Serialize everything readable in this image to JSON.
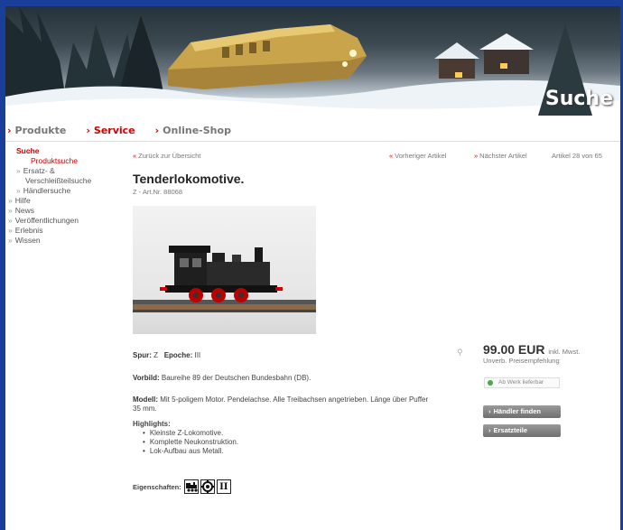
{
  "banner": {
    "title": "Suche"
  },
  "topnav": [
    {
      "label": "Produkte"
    },
    {
      "label": "Service"
    },
    {
      "label": "Online-Shop"
    }
  ],
  "sidebar": {
    "head": "Suche",
    "produktsuche": "Produktsuche",
    "ersatz": "Ersatz- &",
    "ersatz2": "Verschleißteilsuche",
    "haendler": "Händlersuche",
    "items": [
      "Hilfe",
      "News",
      "Veröffentlichungen",
      "Erlebnis",
      "Wissen"
    ]
  },
  "subnav": {
    "back": "Zurück zur Übersicht",
    "prev": "Vorheriger Artikel",
    "next": "Nächster Artikel",
    "count": "Artikel 28 von 65"
  },
  "product": {
    "title": "Tenderlokomotive.",
    "artno": "Z - Art.Nr. 88068",
    "spur_label": "Spur:",
    "spur_value": "Z",
    "epoche_label": "Epoche:",
    "epoche_value": "III",
    "vorbild_label": "Vorbild:",
    "vorbild_text": "Baureihe 89 der Deutschen Bundesbahn (DB).",
    "modell_label": "Modell:",
    "modell_text": "Mit 5-poligem Motor. Pendelachse. Alle Treibachsen angetrieben. Länge über Puffer",
    "modell_text2": "35 mm.",
    "highlights_label": "Highlights:",
    "highlights": [
      "Kleinste Z-Lokomotive.",
      "Komplette Neukonstruktion.",
      "Lok-Aufbau aus Metall."
    ],
    "props_label": "Eigenschaften:",
    "props_icons": [
      "locomotive-icon",
      "gear-wheel-icon",
      "epoch-iii-icon"
    ],
    "props_epoch": "II"
  },
  "pricebox": {
    "price": "99.00 EUR",
    "tax": "inkl. Mwst.",
    "note": "Unverb. Preisempfehlung",
    "availability": "Ab Werk lieferbar",
    "btn_dealer": "Händler finden",
    "btn_parts": "Ersatzteile"
  },
  "colors": {
    "accent": "#cc0000",
    "frame": "#1a3f9a",
    "button": "#7f7f7f"
  }
}
